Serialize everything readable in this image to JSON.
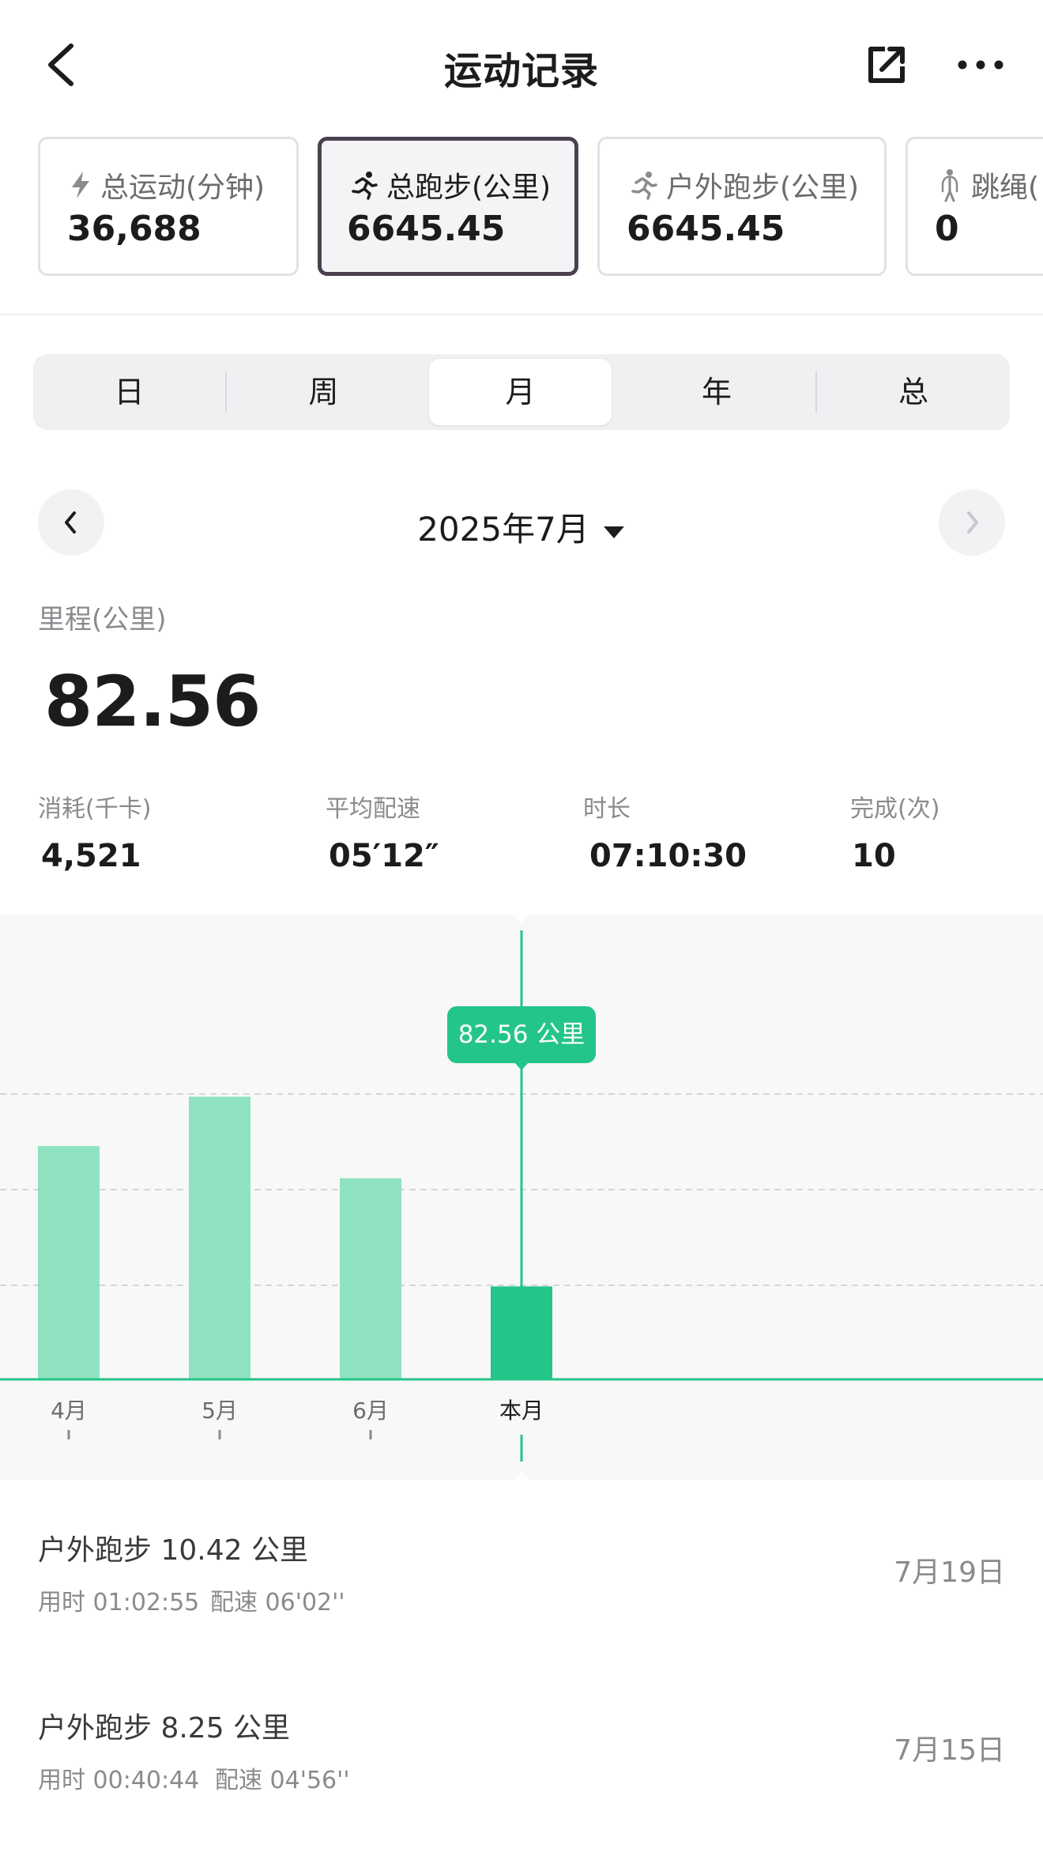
{
  "header": {
    "title": "运动记录"
  },
  "metric_cards": [
    {
      "label": "总运动(分钟)",
      "value": "36,688",
      "icon": "lightning-icon"
    },
    {
      "label": "总跑步(公里)",
      "value": "6645.45",
      "icon": "running-icon",
      "selected": true
    },
    {
      "label": "户外跑步(公里)",
      "value": "6645.45",
      "icon": "running-icon"
    },
    {
      "label": "跳绳(",
      "value": "0",
      "icon": "jump-rope-icon"
    }
  ],
  "period_tabs": [
    {
      "label": "日"
    },
    {
      "label": "周"
    },
    {
      "label": "月",
      "selected": true
    },
    {
      "label": "年"
    },
    {
      "label": "总"
    }
  ],
  "date_nav": {
    "current": "2025年7月"
  },
  "summary": {
    "distance_label": "里程(公里)",
    "distance_value": "82.56",
    "stats": [
      {
        "label": "消耗(千卡)",
        "value": "4,521"
      },
      {
        "label": "平均配速",
        "value": "05′12″"
      },
      {
        "label": "时长",
        "value": "07:10:30"
      },
      {
        "label": "完成(次)",
        "value": "10"
      }
    ]
  },
  "chart_data": {
    "type": "bar",
    "categories": [
      "4月",
      "5月",
      "6月",
      "本月"
    ],
    "values": [
      246,
      298,
      212,
      98
    ],
    "highlight_index": 3,
    "tooltip": "82.56 公里",
    "bar_color": "#8fe2c0",
    "highlight_color": "#24c589",
    "grid": "dashed"
  },
  "records": [
    {
      "title": "户外跑步  10.42 公里",
      "time": "用时 01:02:55",
      "pace": "配速 06'02''",
      "date": "7月19日"
    },
    {
      "title": "户外跑步  8.25 公里",
      "time": "用时 00:40:44",
      "pace": "配速 04'56''",
      "date": "7月15日"
    }
  ]
}
